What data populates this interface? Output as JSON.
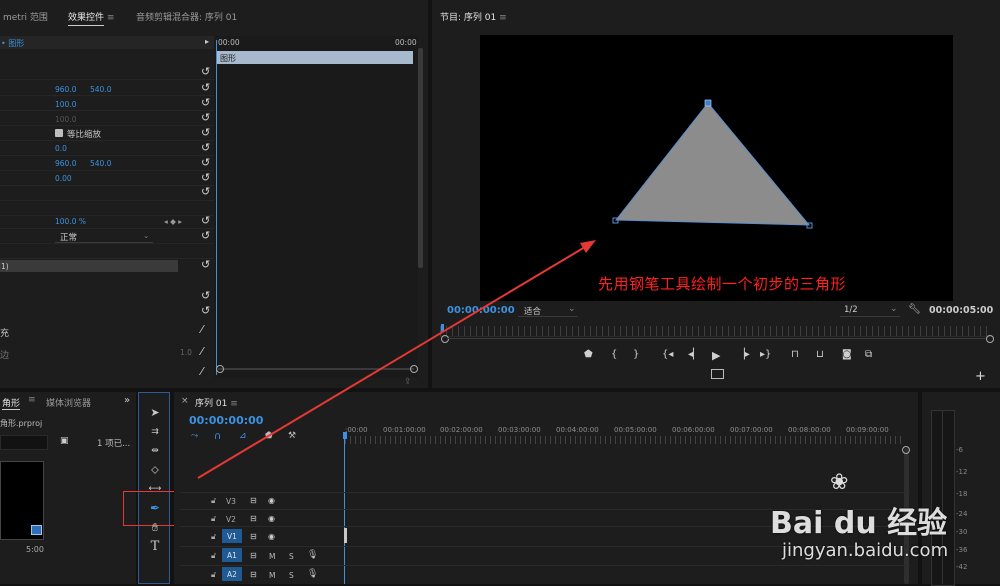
{
  "top_left_tabs": {
    "tab1": "metri 范围",
    "tab2": "效果控件",
    "tab3": "音频剪辑混合器: 序列 01"
  },
  "effect_controls": {
    "clip_label": "• 图形",
    "time_start": "00:00",
    "time_end": "00:00",
    "clip_bar_label": "图形",
    "position_x": "960.0",
    "position_y": "540.0",
    "scale": "100.0",
    "scale_width": "100.0",
    "uniform_scale_label": "等比缩放",
    "rotation": "0.0",
    "anchor_x": "960.0",
    "anchor_y": "540.0",
    "flicker": "0.00",
    "opacity": "100.0 %",
    "keyframe_nav": "◂ ◆ ▸",
    "blend_mode": "正常",
    "shape_item": "1)",
    "fill_label": "充",
    "stroke_label": "边",
    "stroke_value": "1.0"
  },
  "program_monitor": {
    "title": "节目: 序列 01",
    "timecode": "00:00:00:00",
    "fit_label": "适合",
    "quality_label": "1/2",
    "duration": "00:00:05:00",
    "annotation": "先用钢笔工具绘制一个初步的三角形",
    "shape_fill": "#8c8c8c",
    "annotation_color": "#ff2020"
  },
  "project_panel": {
    "tab1": "角形",
    "tab2": "媒体浏览器",
    "file": "角形.prproj",
    "count": "1 项已...",
    "thumb_duration": "5:00"
  },
  "timeline": {
    "title": "序列 01",
    "timecode": "00:00:00:00",
    "ruler": [
      ":00:00",
      "00:01:00:00",
      "00:02:00:00",
      "00:03:00:00",
      "00:04:00:00",
      "00:05:00:00",
      "00:06:00:00",
      "00:07:00:00",
      "00:08:00:00",
      "00:09:00:00"
    ],
    "tracks": [
      {
        "name": "V3",
        "m": "",
        "s": ""
      },
      {
        "name": "V2",
        "m": "",
        "s": ""
      },
      {
        "name": "V1",
        "m": "",
        "s": ""
      },
      {
        "name": "A1",
        "m": "M",
        "s": "S"
      },
      {
        "name": "A2",
        "m": "M",
        "s": "S"
      }
    ]
  },
  "audio_meter": {
    "ticks": [
      "-6",
      "-12",
      "-18",
      "-24",
      "-30",
      "-36",
      "-42"
    ]
  },
  "watermark": {
    "brand": "Bai du 经验",
    "url": "jingyan.baidu.com"
  },
  "colors": {
    "accent": "#3c92e0",
    "highlight": "#e53935"
  }
}
